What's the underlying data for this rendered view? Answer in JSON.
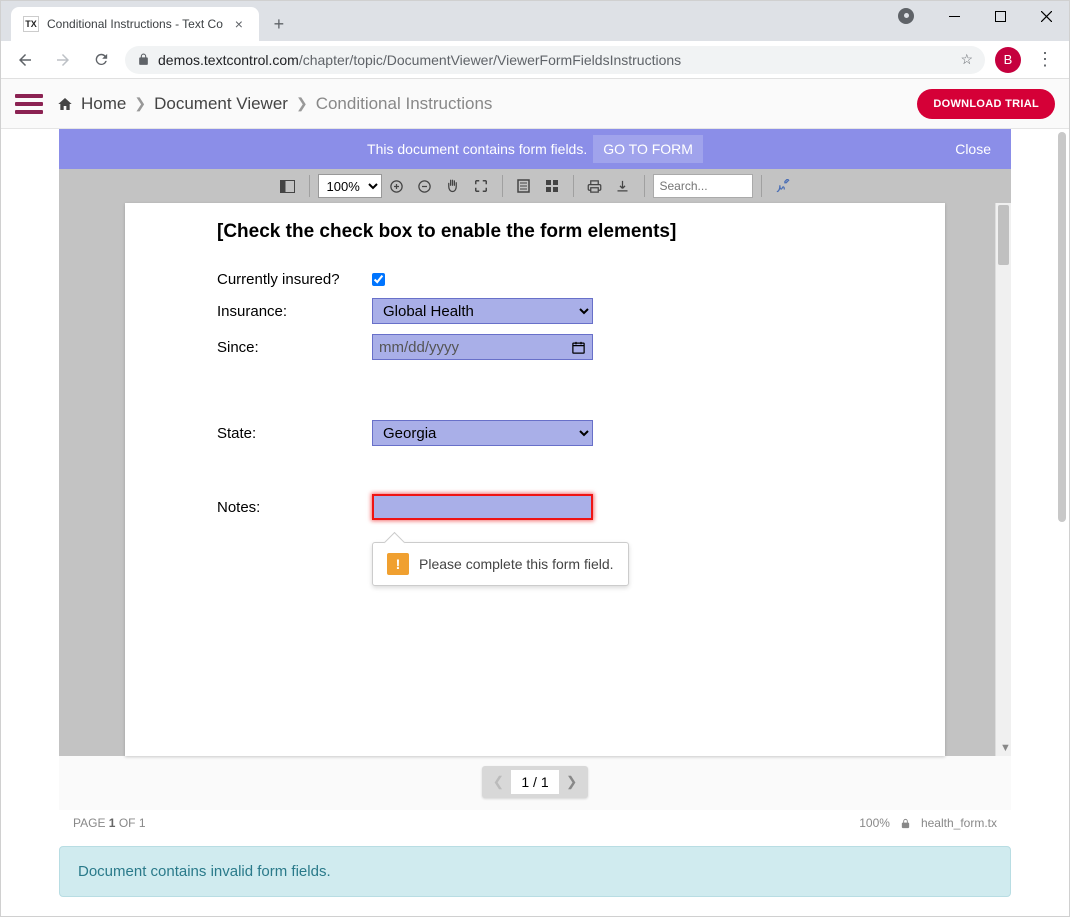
{
  "browser": {
    "tab_title": "Conditional Instructions - Text Co",
    "url_domain": "demos.textcontrol.com",
    "url_path": "/chapter/topic/DocumentViewer/ViewerFormFieldsInstructions",
    "profile_initial": "B"
  },
  "header": {
    "crumb_home": "Home",
    "crumb_viewer": "Document Viewer",
    "crumb_current": "Conditional Instructions",
    "download_btn": "DOWNLOAD TRIAL"
  },
  "banner": {
    "text": "This document contains form fields.",
    "goto_btn": "GO TO FORM",
    "close": "Close"
  },
  "toolbar": {
    "zoom": "100%",
    "search_placeholder": "Search..."
  },
  "doc": {
    "heading": "[Check the check box to enable the form elements]",
    "label_insured": "Currently insured?",
    "label_insurance": "Insurance:",
    "label_since": "Since:",
    "label_state": "State:",
    "label_notes": "Notes:",
    "insurance_value": "Global Health",
    "since_placeholder": "mm/dd/yyyy",
    "state_value": "Georgia",
    "notes_value": "",
    "validation_msg": "Please complete this form field."
  },
  "pager": {
    "display": "1 / 1"
  },
  "status": {
    "page_prefix": "PAGE ",
    "page_num": "1",
    "page_suffix": " OF 1",
    "zoom": "100%",
    "filename": "health_form.tx"
  },
  "alert": {
    "text": "Document contains invalid form fields."
  }
}
